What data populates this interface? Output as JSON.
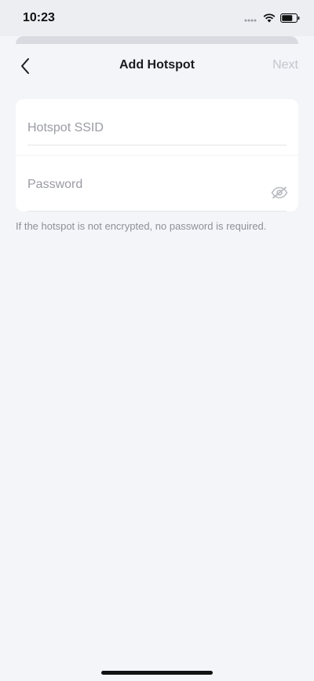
{
  "status_bar": {
    "time": "10:23"
  },
  "nav": {
    "title": "Add Hotspot",
    "next_label": "Next"
  },
  "form": {
    "ssid": {
      "placeholder": "Hotspot SSID",
      "value": ""
    },
    "password": {
      "placeholder": "Password",
      "value": ""
    }
  },
  "hint": "If the hotspot is not encrypted, no password is required.",
  "icons": {
    "back": "chevron-left-icon",
    "visibility": "eye-off-icon",
    "wifi": "wifi-icon",
    "battery": "battery-icon",
    "signal": "cellular-signal-icon"
  },
  "colors": {
    "background": "#f4f5f9",
    "card": "#ffffff",
    "disabled_text": "#c3c5cb",
    "placeholder": "#9a9ca3"
  }
}
